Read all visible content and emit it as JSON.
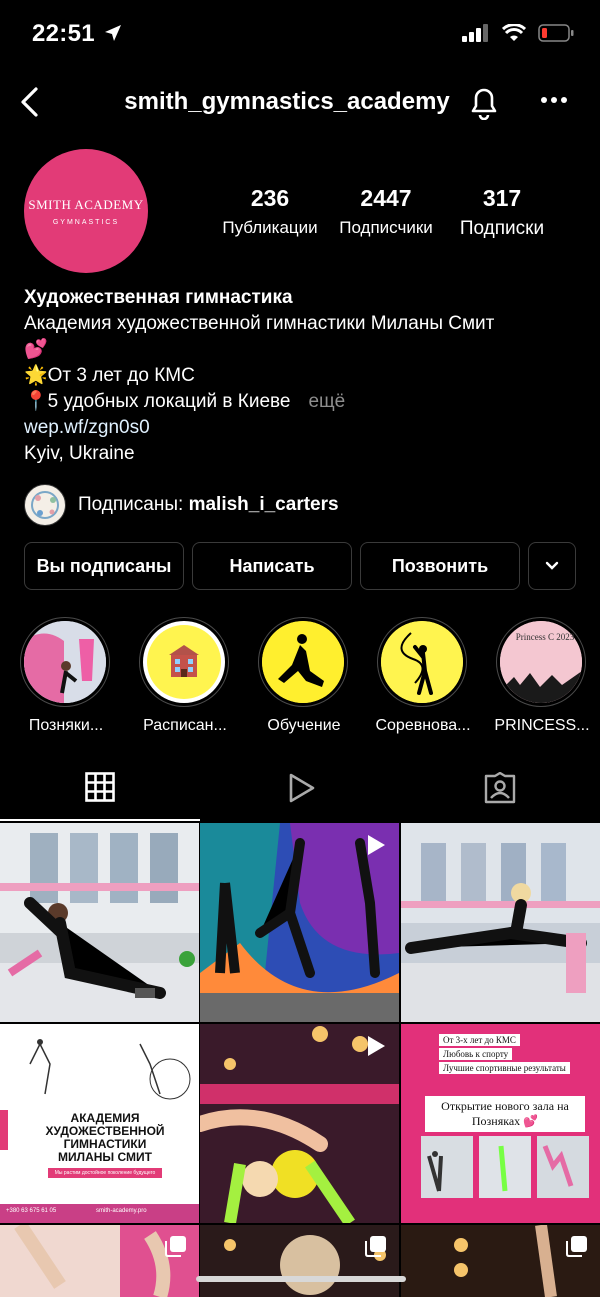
{
  "status": {
    "time": "22:51"
  },
  "nav": {
    "username": "smith_gymnastics_academy"
  },
  "avatar": {
    "line1": "SMITH ACADEMY",
    "line2": "GYMNASTICS",
    "color": "#e23b77"
  },
  "stats": [
    {
      "value": "236",
      "label": "Публикации"
    },
    {
      "value": "2447",
      "label": "Подписчики"
    },
    {
      "value": "317",
      "label": "Подписки"
    }
  ],
  "bio": {
    "name": "Художественная гимнастика",
    "line1": "Академия художественной гимнастики Миланы Смит",
    "line2": "💕",
    "line3": "🌟От 3 лет до КМС",
    "line4": "📍5 удобных локаций в Киеве",
    "more": "ещё",
    "link": "wep.wf/zgn0s0",
    "location": "Kyiv, Ukraine"
  },
  "followed_by": {
    "prefix": "Подписаны:",
    "user": "malish_i_carters"
  },
  "buttons": {
    "following": "Вы подписаны",
    "message": "Написать",
    "call": "Позвонить"
  },
  "highlights": [
    {
      "label": "Позняки...",
      "color": "#cfd6e4"
    },
    {
      "label": "Расписан...",
      "color": "#fff44f"
    },
    {
      "label": "Обучение",
      "color": "#ffef2e"
    },
    {
      "label": "Соревнова...",
      "color": "#fff44f"
    },
    {
      "label": "PRINCESS...",
      "color": "#f4c7d1"
    }
  ],
  "grid": {
    "post6_lines": [
      "От 3-х лет до КМС",
      "Любовь к спорту",
      "Лучшие спортивные результаты"
    ],
    "post6_title": "Открытие нового зала на Позняках 💕",
    "post4_title": "АКАДЕМИЯ ХУДОЖЕСТВЕННОЙ ГИМНАСТИКИ МИЛАНЫ СМИТ",
    "post4_sub": "Мы растим достойное поколение будущего",
    "post4_phone": "+380 63 675 61 05",
    "post4_site": "smith-academy.pro",
    "princess_text": "Princess C 2023"
  }
}
